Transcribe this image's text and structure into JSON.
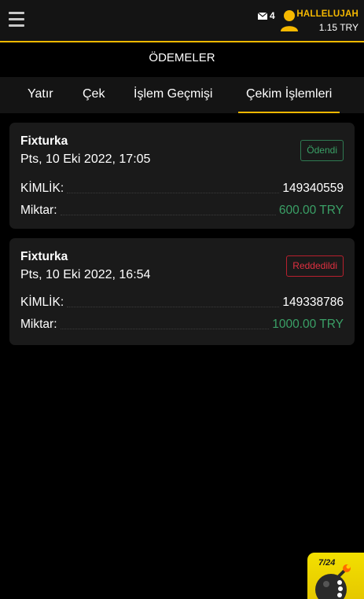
{
  "header": {
    "mail_count": "4",
    "username": "HALLELUJAH",
    "balance": "1.15 TRY"
  },
  "page": {
    "title": "ÖDEMELER"
  },
  "tabs": [
    {
      "label": "Yatır"
    },
    {
      "label": "Çek"
    },
    {
      "label": "İşlem Geçmişi"
    },
    {
      "label": "Çekim İşlemleri"
    }
  ],
  "withdrawals": [
    {
      "provider": "Fixturka",
      "date": "Pts, 10 Eki 2022, 17:05",
      "status": "Ödendi",
      "id_label": "KİMLİK:",
      "id": "149340559",
      "amount_label": "Miktar:",
      "amount": "600.00 TRY"
    },
    {
      "provider": "Fixturka",
      "date": "Pts, 10 Eki 2022, 16:54",
      "status": "Reddedildi",
      "id_label": "KİMLİK:",
      "id": "149338786",
      "amount_label": "Miktar:",
      "amount": "1000.00 TRY"
    }
  ],
  "promo": {
    "text": "7/24"
  },
  "colors": {
    "accent": "#f5b800",
    "paid": "#3aa066",
    "rejected": "#e03040"
  }
}
